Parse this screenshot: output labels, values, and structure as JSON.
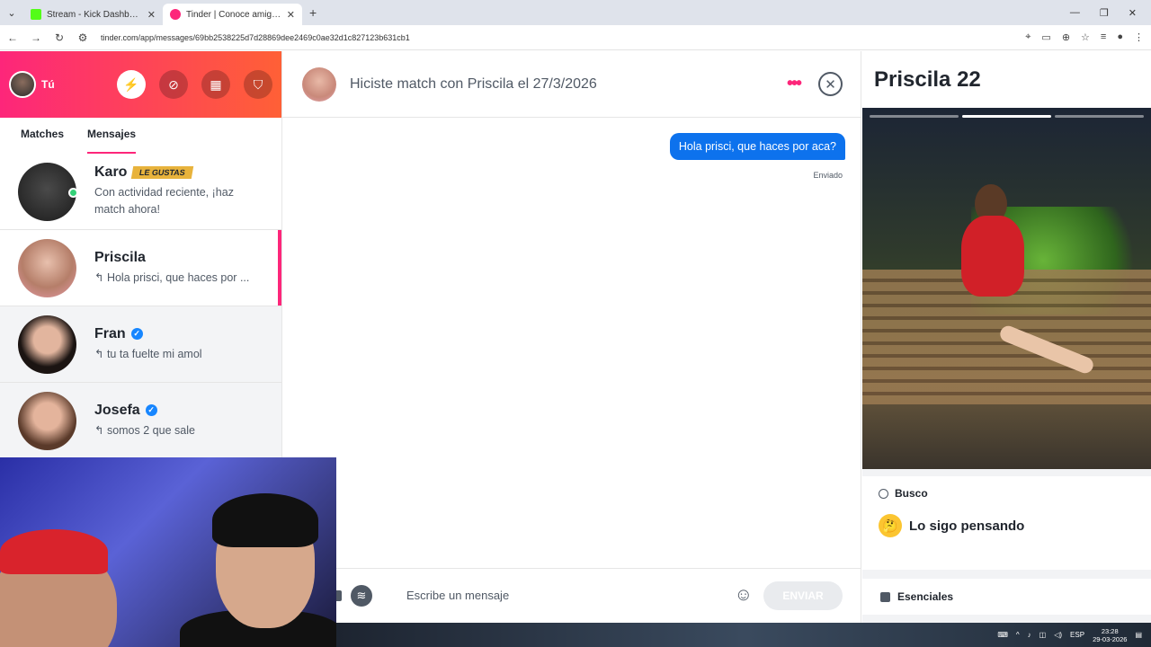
{
  "browser": {
    "tabs": [
      {
        "label": "Stream - Kick Dashboard",
        "favicon_color": "#53fc18",
        "active": false
      },
      {
        "label": "Tinder | Conoce amigos y gente",
        "favicon_color": "#fd267a",
        "active": true
      }
    ],
    "url": "tinder.com/app/messages/69bb2538225d7d28869dee2469c0ae32d1c827123b631cb1"
  },
  "left_panel": {
    "me_label": "Tú",
    "tabs": [
      "Matches",
      "Mensajes"
    ],
    "conversations": [
      {
        "name": "Karo",
        "badge": "LE GUSTAS",
        "message": "Con actividad reciente, ¡haz match ahora!",
        "verified": false,
        "online": true
      },
      {
        "name": "Priscila",
        "badge": "",
        "message": "↰ Hola prisci, que haces por ...",
        "verified": false,
        "online": false
      },
      {
        "name": "Fran",
        "badge": "",
        "message": "↰ tu ta fuelte mi amol",
        "verified": true,
        "online": false
      },
      {
        "name": "Josefa",
        "badge": "",
        "message": "↰ somos 2 que sale",
        "verified": true,
        "online": false
      }
    ]
  },
  "chat": {
    "header": "Hiciste match con Priscila el 27/3/2026",
    "message": "Hola prisci, que haces por aca?",
    "status": "Enviado",
    "placeholder": "Escribe un mensaje",
    "send_label": "ENVIAR"
  },
  "profile": {
    "name": "Priscila 22",
    "busco_label": "Busco",
    "busco_value": "Lo sigo pensando",
    "essentials_label": "Esenciales"
  },
  "taskbar": {
    "lang": "ESP",
    "time": "23:28",
    "date": "29-03-2026"
  },
  "colors": {
    "brand_gradient_start": "#fd267a",
    "brand_gradient_end": "#ff6036",
    "bubble": "#0d72ed"
  }
}
